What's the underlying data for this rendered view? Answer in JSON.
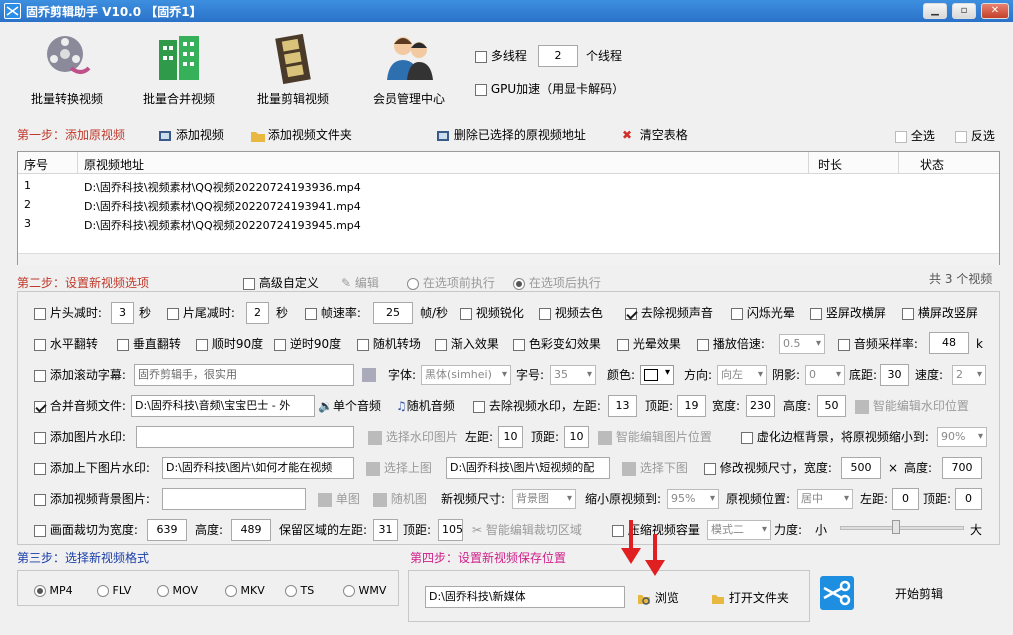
{
  "window": {
    "title": "固乔剪辑助手 V10.0  【固乔1】"
  },
  "toolbar": [
    {
      "label": "批量转换视频",
      "icon": "film-reel-icon"
    },
    {
      "label": "批量合并视频",
      "icon": "building-blocks-icon"
    },
    {
      "label": "批量剪辑视频",
      "icon": "film-strip-icon"
    },
    {
      "label": "会员管理中心",
      "icon": "users-icon"
    }
  ],
  "threads": {
    "multi_label": "多线程",
    "count": "2",
    "unit": "个线程",
    "gpu_label": "GPU加速（用显卡解码）"
  },
  "step1": {
    "title": "第一步：添加原视频",
    "add_video": "添加视频",
    "add_folder": "添加视频文件夹",
    "delete_selected": "删除已选择的原视频地址",
    "clear_table": "清空表格",
    "select_all": "全选",
    "invert": "反选"
  },
  "table": {
    "headers": {
      "index": "序号",
      "path": "原视频地址",
      "duration": "时长",
      "status": "状态"
    },
    "rows": [
      {
        "index": "1",
        "path": "D:\\固乔科技\\视频素材\\QQ视频20220724193936.mp4"
      },
      {
        "index": "2",
        "path": "D:\\固乔科技\\视频素材\\QQ视频20220724193941.mp4"
      },
      {
        "index": "3",
        "path": "D:\\固乔科技\\视频素材\\QQ视频20220724193945.mp4"
      }
    ]
  },
  "step2": {
    "title": "第二步：设置新视频选项",
    "advanced": "高级自定义",
    "edit": "编辑",
    "before": "在选项前执行",
    "after": "在选项后执行",
    "count_text": "共 3 个视频"
  },
  "opts": {
    "r1": {
      "head_cut": "片头减时:",
      "head_val": "3",
      "sec": "秒",
      "tail_cut": "片尾减时:",
      "tail_val": "2",
      "sec2": "秒",
      "fps": "帧速率:",
      "fps_val": "25",
      "fps_unit": "帧/秒",
      "sharpen": "视频锐化",
      "decolor": "视频去色",
      "remove_audio": "去除视频声音",
      "flash": "闪烁光晕",
      "v2h": "竖屏改横屏",
      "h2v": "横屏改竖屏"
    },
    "r2": {
      "hflip": "水平翻转",
      "vflip": "垂直翻转",
      "cw90": "顺时90度",
      "ccw90": "逆时90度",
      "random_trans": "随机转场",
      "fadein": "渐入效果",
      "color_fx": "色彩变幻效果",
      "halo": "光晕效果",
      "speed": "播放倍速:",
      "speed_val": "0.5",
      "sample": "音频采样率:",
      "sample_val": "48",
      "sample_unit": "k"
    },
    "r3": {
      "scroll": "添加滚动字幕:",
      "scroll_text": "固乔剪辑手，很实用",
      "font": "字体:",
      "font_val": "黑体(simhei)",
      "size": "字号:",
      "size_val": "35",
      "color": "颜色:",
      "dir": "方向:",
      "dir_val": "向左",
      "shadow": "阴影:",
      "shadow_val": "0",
      "bottom": "底距:",
      "bottom_val": "30",
      "speed": "速度:",
      "speed_val": "2"
    },
    "r4": {
      "merge_audio": "合并音频文件:",
      "audio_path": "D:\\固乔科技\\音频\\宝宝巴士 - 外",
      "single": "单个音频",
      "random": "随机音频",
      "remove_wm": "去除视频水印，左距:",
      "left_val": "13",
      "top": "顶距:",
      "top_val": "19",
      "width": "宽度:",
      "width_val": "230",
      "height": "高度:",
      "height_val": "50",
      "smart_wm": "智能编辑水印位置"
    },
    "r5": {
      "img_wm": "添加图片水印:",
      "choose_img": "选择水印图片",
      "left": "左距:",
      "left_val": "10",
      "top": "顶距:",
      "top_val": "10",
      "smart_img": "智能编辑图片位置",
      "blur_bg": "虚化边框背景，将原视频缩小到:",
      "blur_val": "90%"
    },
    "r6": {
      "topbottom": "添加上下图片水印:",
      "top_path": "D:\\固乔科技\\图片\\如何才能在视频",
      "choose_top": "选择上图",
      "bottom_path": "D:\\固乔科技\\图片\\短视频的配",
      "choose_bottom": "选择下图",
      "resize": "修改视频尺寸，宽度:",
      "w_val": "500",
      "times": "×",
      "h_label": "高度:",
      "h_val": "700"
    },
    "r7": {
      "bg_img": "添加视频背景图片:",
      "single": "单图",
      "random": "随机图",
      "new_size": "新视频尺寸:",
      "new_size_val": "背景图",
      "shrink": "缩小原视频到:",
      "shrink_val": "95%",
      "pos": "原视频位置:",
      "pos_val": "居中",
      "left": "左距:",
      "left_val": "0",
      "top": "顶距:",
      "top_val": "0"
    },
    "r8": {
      "crop": "画面裁切为宽度:",
      "crop_w": "639",
      "height": "高度:",
      "crop_h": "489",
      "keep_left": "保留区域的左距:",
      "keep_left_val": "31",
      "top": "顶距:",
      "top_val": "105",
      "smart_crop": "智能编辑裁切区域",
      "compress": "压缩视频容量",
      "mode_val": "模式二",
      "strength": "力度:",
      "small": "小",
      "big": "大",
      "strength_level": 0.45
    }
  },
  "step3": {
    "title": "第三步：选择新视频格式",
    "formats": [
      "MP4",
      "FLV",
      "MOV",
      "MKV",
      "TS",
      "WMV"
    ],
    "selected": "MP4"
  },
  "step4": {
    "title": "第四步：设置新视频保存位置",
    "path": "D:\\固乔科技\\新媒体",
    "browse": "浏览",
    "open_folder": "打开文件夹"
  },
  "start": {
    "label": "开始剪辑",
    "icon": "scissors-icon"
  },
  "colors": {
    "titlebar": "#2a72c8",
    "step": "#c0392b",
    "step34": "#1a3ea8",
    "step4": "#d0208a",
    "arrow": "#e02020"
  }
}
